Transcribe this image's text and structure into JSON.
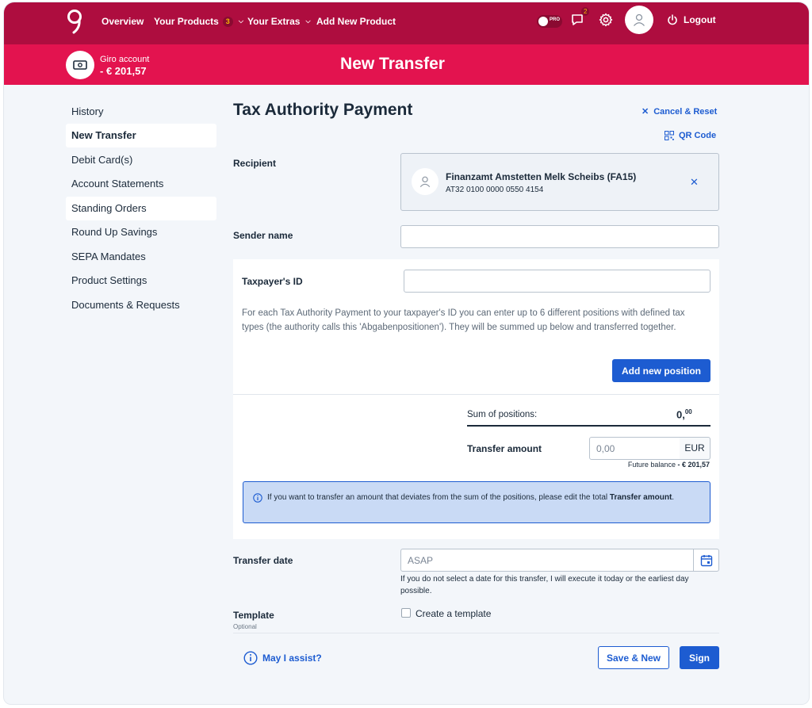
{
  "topbar": {
    "nav": [
      "Overview",
      "Your Products",
      "Your Extras",
      "Add New Product"
    ],
    "products_badge": "3",
    "pro_label": "PRO",
    "messages_badge": "2",
    "logout": "Logout"
  },
  "account": {
    "name": "Giro account",
    "balance": "- € 201,57"
  },
  "page_title": "New Transfer",
  "sidebar": {
    "items": [
      "History",
      "New Transfer",
      "Debit Card(s)",
      "Account Statements",
      "Standing Orders",
      "Round Up Savings",
      "SEPA Mandates",
      "Product Settings",
      "Documents & Requests"
    ],
    "active": "New Transfer"
  },
  "form": {
    "title": "Tax Authority Payment",
    "cancel_reset": "Cancel & Reset",
    "qr_code": "QR Code",
    "recipient_label": "Recipient",
    "recipient_name": "Finanzamt Amstetten Melk Scheibs (FA15)",
    "recipient_iban": "AT32 0100 0000 0550 4154",
    "sender_label": "Sender name",
    "sender_value": "",
    "taxpayer_label": "Taxpayer's ID",
    "taxpayer_value": "",
    "tax_info": "For each Tax Authority Payment to your taxpayer's ID you can enter up to 6 different positions with defined tax types (the authority calls this 'Abgabenpositionen'). They will be summed up below and transferred together.",
    "add_position": "Add new position",
    "sum_label": "Sum of positions:",
    "sum_value_int": "0,",
    "sum_value_dec": "00",
    "amount_label": "Transfer amount",
    "amount_placeholder": "0,00",
    "currency": "EUR",
    "future_label": "Future balance",
    "future_value": "- € 201,57",
    "info_text_pre": "If you want to transfer an amount that deviates from the sum of the positions, please edit the total ",
    "info_text_bold": "Transfer amount",
    "info_text_post": ".",
    "date_label": "Transfer date",
    "date_placeholder": "ASAP",
    "date_help": "If you do not select a date for this transfer, I will execute it today or the earliest day possible.",
    "template_label": "Template",
    "template_optional": "Optional",
    "template_checkbox": "Create a template",
    "assist": "May I assist?",
    "save_new": "Save & New",
    "sign": "Sign"
  },
  "colors": {
    "topbar": "#ae0d3f",
    "subbar": "#e3134f",
    "primary": "#1d5cd1",
    "background": "#f3f6fa"
  }
}
